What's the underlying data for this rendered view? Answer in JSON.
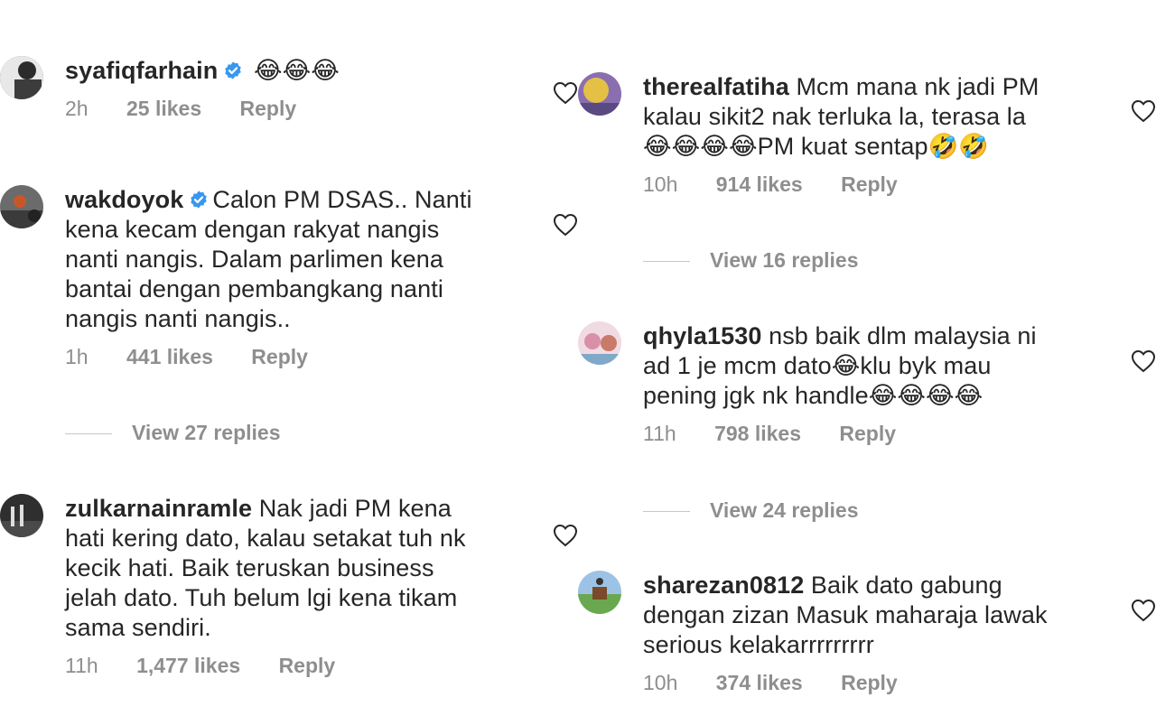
{
  "left": {
    "comments": [
      {
        "username": "syafiqfarhain",
        "verified": true,
        "text": " 😂😂😂",
        "time": "2h",
        "likes": "25 likes",
        "reply": "Reply"
      },
      {
        "username": "wakdoyok",
        "verified": true,
        "text": "Calon PM DSAS.. Nanti\nkena kecam dengan rakyat nangis\nnanti nangis. Dalam parlimen kena\nbantai dengan pembangkang nanti\nnangis nanti nangis..",
        "time": "1h",
        "likes": "441 likes",
        "reply": "Reply",
        "view_replies": "View 27 replies"
      },
      {
        "username": "zulkarnainramle",
        "verified": false,
        "text": " Nak jadi PM kena\nhati kering dato, kalau setakat tuh nk\nkecik hati. Baik teruskan business\njelah dato. Tuh belum lgi kena tikam\nsama sendiri.",
        "time": "11h",
        "likes": "1,477 likes",
        "reply": "Reply"
      }
    ]
  },
  "right": {
    "comments": [
      {
        "username": "therealfatiha",
        "verified": false,
        "text": " Mcm mana nk jadi PM\nkalau sikit2 nak terluka la, terasa la\n😂😂😂😂PM kuat sentap🤣🤣",
        "time": "10h",
        "likes": "914 likes",
        "reply": "Reply",
        "view_replies": "View 16 replies"
      },
      {
        "username": "qhyla1530",
        "verified": false,
        "text": " nsb baik dlm malaysia ni\nad 1 je mcm dato😂klu byk mau\npening jgk nk handle😂😂😂😂",
        "time": "11h",
        "likes": "798 likes",
        "reply": "Reply",
        "view_replies": "View 24 replies"
      },
      {
        "username": "sharezan0812",
        "verified": false,
        "text": " Baik dato gabung\ndengan zizan Masuk maharaja lawak\nserious kelakarrrrrrrrr",
        "time": "10h",
        "likes": "374 likes",
        "reply": "Reply"
      }
    ]
  },
  "icons": {
    "like": "heart-outline-icon",
    "verified": "verified-badge-icon"
  },
  "colors": {
    "verified": "#3897f0",
    "meta": "#8e8e8e",
    "text": "#262626"
  }
}
